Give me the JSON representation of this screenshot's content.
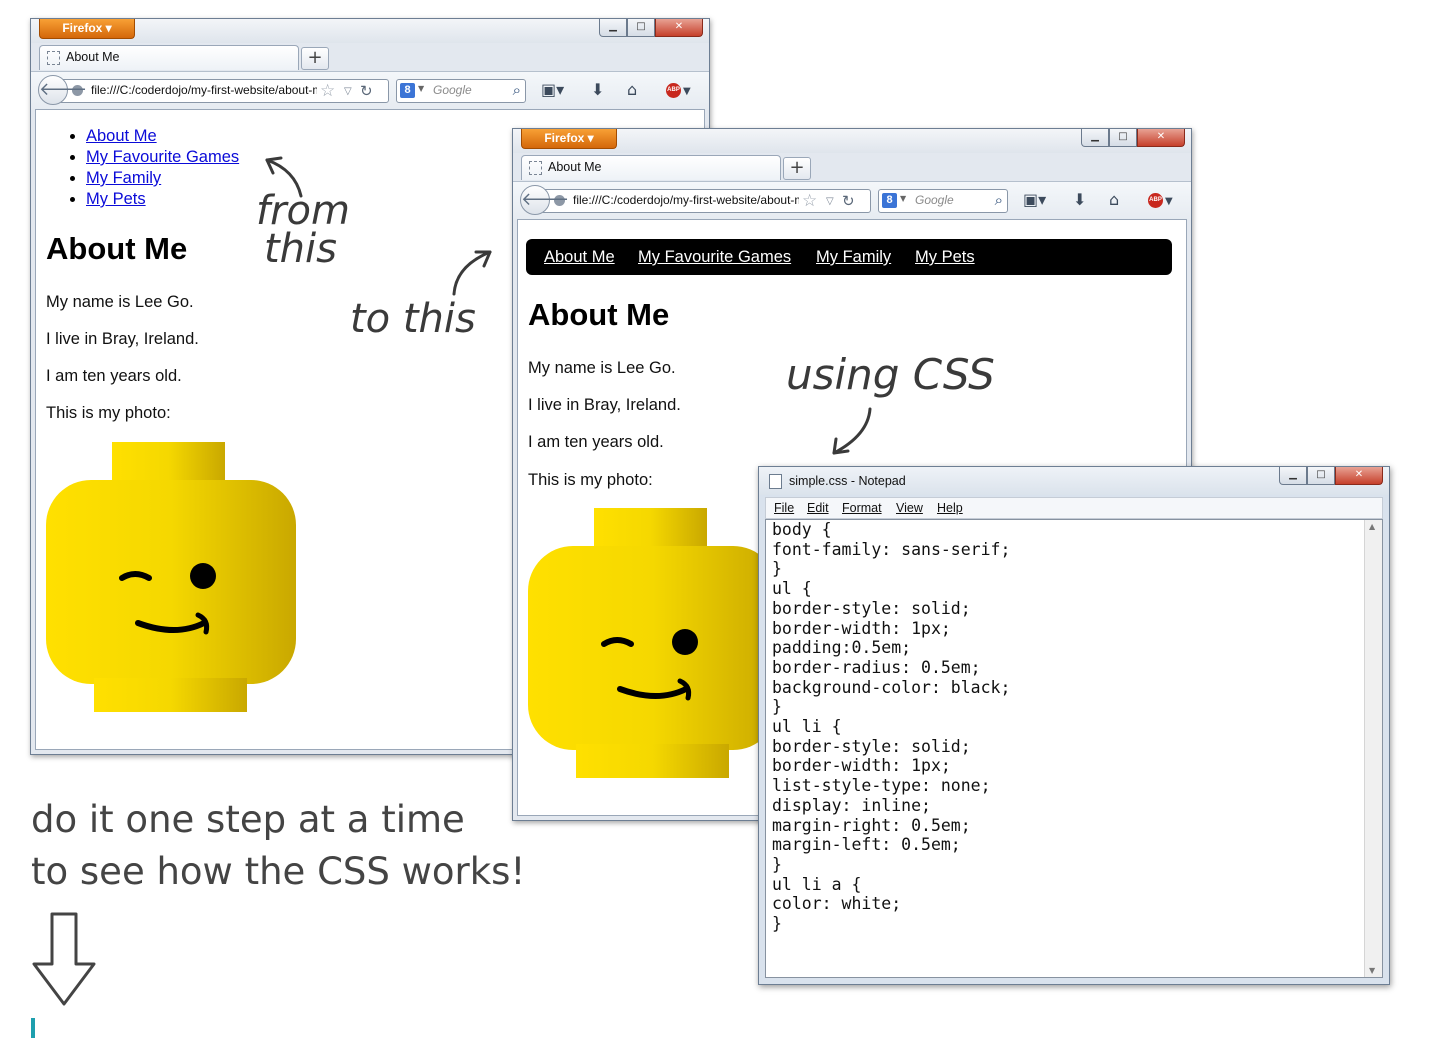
{
  "browser": {
    "app_button": "Firefox",
    "tab_title": "About Me",
    "url": "file:///C:/coderdojo/my-first-website/about-me.html",
    "search_placeholder": "Google",
    "search_engine_icon": "g-icon",
    "abp_label": "ABP"
  },
  "page": {
    "nav": [
      "About Me",
      "My Favourite Games",
      "My Family",
      "My Pets"
    ],
    "heading": "About Me",
    "paragraphs": [
      "My name is Lee Go.",
      "I live in Bray, Ireland.",
      "I am ten years old.",
      "This is my photo:"
    ]
  },
  "notepad": {
    "title": "simple.css - Notepad",
    "menu": [
      "File",
      "Edit",
      "Format",
      "View",
      "Help"
    ],
    "code": "body {\nfont-family: sans-serif;\n}\nul {\nborder-style: solid;\nborder-width: 1px;\npadding:0.5em;\nborder-radius: 0.5em;\nbackground-color: black;\n}\nul li {\nborder-style: solid;\nborder-width: 1px;\nlist-style-type: none;\ndisplay: inline;\nmargin-right: 0.5em;\nmargin-left: 0.5em;\n}\nul li a {\ncolor: white;\n}"
  },
  "annotations": {
    "from_line1": "from",
    "from_line2": "this",
    "to_this": "to this",
    "using_css": "using CSS",
    "caption_line1": "do it one step at a time",
    "caption_line2": "to see how the CSS works!"
  },
  "colors": {
    "link": "#0b0bd8",
    "nav_bar_bg": "#000000",
    "firefox_orange": "#e8830f",
    "accent": "#1e9fae"
  },
  "icons": {
    "back": "back-arrow-icon",
    "star": "bookmark-star-icon",
    "reload": "reload-icon",
    "search": "magnifier-icon",
    "bookmarks": "bookmarks-icon",
    "download": "download-icon",
    "home": "home-icon",
    "down_arrow": "down-arrow-icon"
  }
}
